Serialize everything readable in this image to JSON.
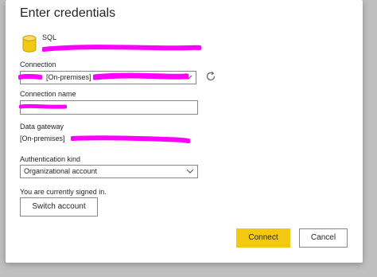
{
  "dialog": {
    "title": "Enter credentials",
    "source_type": "SQL",
    "source_icon": "database-icon"
  },
  "connection": {
    "label": "Connection",
    "value": "[On-premises]"
  },
  "connection_name": {
    "label": "Connection name",
    "value": ""
  },
  "gateway": {
    "label": "Data gateway",
    "value": "[On-premises]"
  },
  "auth": {
    "label": "Authentication kind",
    "value": "Organizational account"
  },
  "signin": {
    "status": "You are currently signed in.",
    "switch_label": "Switch account"
  },
  "footer": {
    "connect_label": "Connect",
    "cancel_label": "Cancel"
  },
  "colors": {
    "primary": "#f2c811",
    "redaction": "#ff00ff",
    "db_icon": "#f2c811"
  }
}
